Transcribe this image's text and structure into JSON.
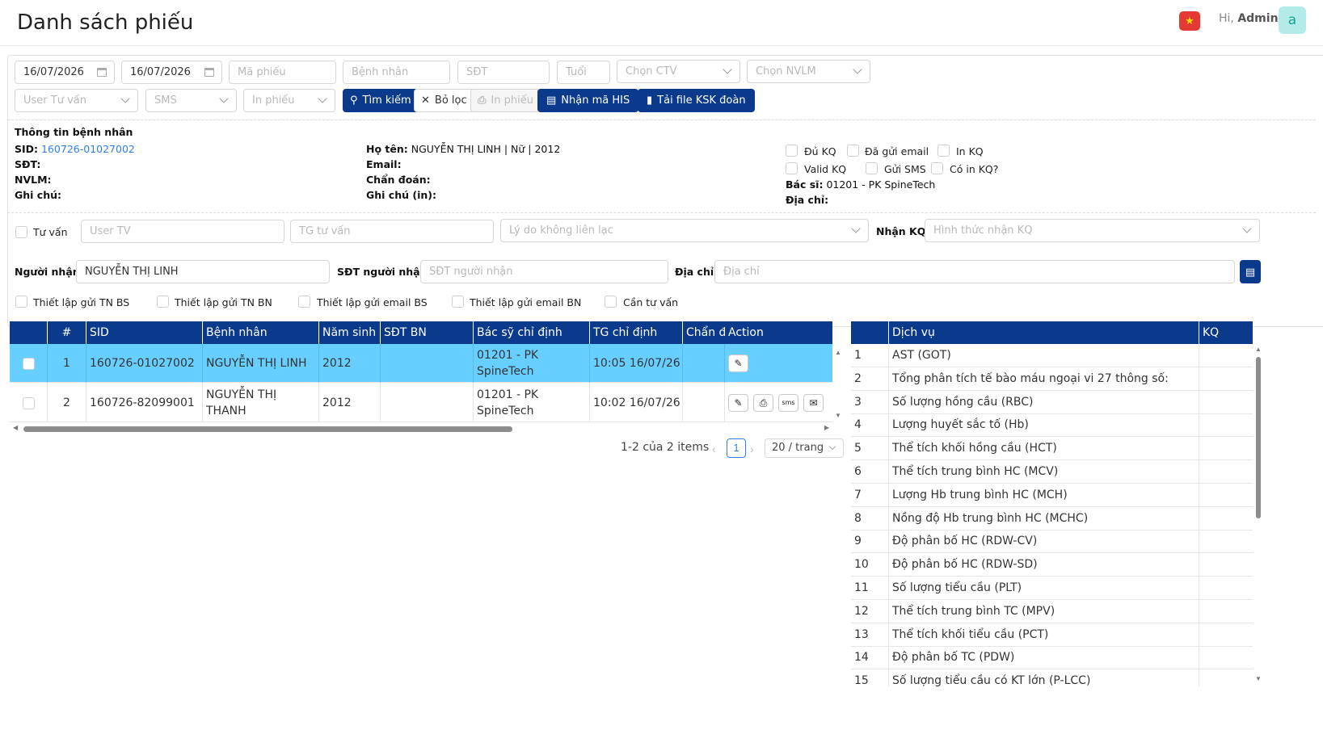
{
  "header": {
    "title": "Danh sách phiếu",
    "greeting_prefix": "Hi, ",
    "user_name": "Admin",
    "avatar_letter": "a",
    "flag_icon": "vietnam-flag-icon"
  },
  "filters": {
    "from_date": "16/07/2026",
    "to_date": "16/07/2026",
    "ma_phieu_placeholder": "Mã phiếu",
    "benh_nhan_placeholder": "Bệnh nhân",
    "sdt_placeholder": "SĐT",
    "tuoi_placeholder": "Tuổi",
    "ctv_placeholder": "Chọn CTV",
    "nvlm_placeholder": "Chọn NVLM",
    "user_tu_van_placeholder": "User Tư vấn",
    "sms_placeholder": "SMS",
    "in_phieu_placeholder": "In phiếu",
    "search_label": "Tìm kiếm",
    "clear_label": "Bỏ lọc",
    "print_label": "In phiếu",
    "his_label": "Nhận mã HIS",
    "ksk_label": "Tải file KSK đoàn"
  },
  "patient": {
    "section_title": "Thông tin bệnh nhân",
    "sid_label": "SID:",
    "sid_value": "160726-01027002",
    "sdt_label": "SĐT:",
    "nvlm_label": "NVLM:",
    "ghichu_label": "Ghi chú:",
    "hoten_label": "Họ tên:",
    "hoten_value": "NGUYỄN THỊ LINH | Nữ | 2012",
    "email_label": "Email:",
    "chandoan_label": "Chẩn đoán:",
    "ghichu_in_label": "Ghi chú (in):",
    "checks": {
      "du_kq": "Đủ KQ",
      "da_gui_email": "Đã gửi email",
      "in_kq": "In KQ",
      "valid_kq": "Valid KQ",
      "gui_sms": "Gửi SMS",
      "co_in_kq": "Có in KQ?"
    },
    "bacsi_label": "Bác sĩ:",
    "bacsi_value": "01201 - PK SpineTech",
    "diachi_label": "Địa chỉ:"
  },
  "consult": {
    "tu_van_label": "Tư vấn",
    "user_tv_placeholder": "User TV",
    "tg_tu_van_placeholder": "TG tư vấn",
    "ly_do_placeholder": "Lý do không liên lạc",
    "nhan_kq_label": "Nhận KQ:",
    "hinh_thuc_placeholder": "Hình thức nhận KQ",
    "nguoi_nhan_label": "Người nhận:",
    "nguoi_nhan_value": "NGUYỄN THỊ LINH",
    "sdt_nguoi_nhan_label": "SĐT người nhận:",
    "sdt_nguoi_nhan_placeholder": "SĐT người nhận",
    "dia_chi_label": "Địa chỉ:",
    "dia_chi_placeholder": "Địa chỉ",
    "settings": [
      "Thiết lập gửi TN BS",
      "Thiết lập gửi TN BN",
      "Thiết lập gửi email BS",
      "Thiết lập gửi email BN",
      "Cần tư vấn"
    ]
  },
  "table": {
    "columns": [
      "",
      "#",
      "SID",
      "Bệnh nhân",
      "Năm sinh",
      "SĐT BN",
      "Bác sỹ chỉ định",
      "TG chỉ định",
      "Chẩn đoán",
      "Action"
    ],
    "rows": [
      {
        "no": "1",
        "sid": "160726-01027002",
        "name": "NGUYỄN THỊ LINH",
        "year": "2012",
        "phone": "",
        "doctor": "01201 - PK SpineTech",
        "time": "10:05 16/07/26",
        "diag": "",
        "selected": true
      },
      {
        "no": "2",
        "sid": "160726-82099001",
        "name": "NGUYỄN THỊ THANH",
        "year": "2012",
        "phone": "",
        "doctor": "01201 - PK SpineTech",
        "time": "10:02 16/07/26",
        "diag": "",
        "selected": false
      }
    ],
    "pager": {
      "total": "1-2 của 2 items",
      "page": "1",
      "size": "20 / trang"
    }
  },
  "services": {
    "columns": [
      "",
      "Dịch vụ",
      "KQ"
    ],
    "rows": [
      {
        "no": "1",
        "name": "AST (GOT)"
      },
      {
        "no": "2",
        "name": "Tổng phân tích tế bào máu ngoại vi 27 thông số:"
      },
      {
        "no": "3",
        "name": "Số lượng hồng cầu (RBC)"
      },
      {
        "no": "4",
        "name": "Lượng huyết sắc tố (Hb)"
      },
      {
        "no": "5",
        "name": "Thể tích khối hồng cầu (HCT)"
      },
      {
        "no": "6",
        "name": "Thể tích trung bình HC (MCV)"
      },
      {
        "no": "7",
        "name": "Lượng Hb trung bình HC (MCH)"
      },
      {
        "no": "8",
        "name": "Nồng độ Hb trung bình HC (MCHC)"
      },
      {
        "no": "9",
        "name": "Độ phân bố HC (RDW-CV)"
      },
      {
        "no": "10",
        "name": "Độ phân bố HC (RDW-SD)"
      },
      {
        "no": "11",
        "name": "Số lượng tiểu cầu (PLT)"
      },
      {
        "no": "12",
        "name": "Thể tích trung bình TC (MPV)"
      },
      {
        "no": "13",
        "name": "Thể tích khối tiểu cầu (PCT)"
      },
      {
        "no": "14",
        "name": "Độ phân bố TC (PDW)"
      },
      {
        "no": "15",
        "name": "Số lượng tiểu cầu có KT lớn (P-LCC)"
      }
    ]
  },
  "colors": {
    "primary": "#0b3a8c",
    "selected_row": "#67cfff",
    "link": "#2f80ed"
  }
}
